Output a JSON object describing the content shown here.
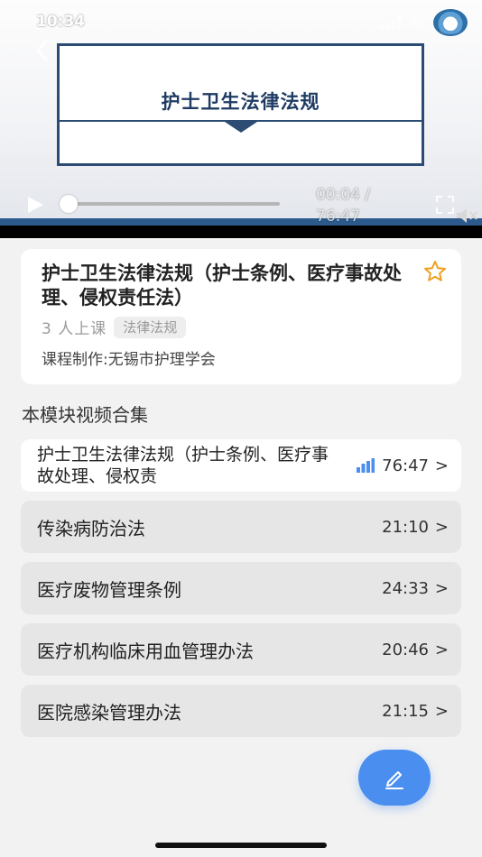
{
  "status_bar": {
    "time": "10:34"
  },
  "player": {
    "slide_title": "护士卫生法律法规",
    "current_time": "00:04 /",
    "total_time": "76:47",
    "progress": 0.0009
  },
  "course": {
    "title": "护士卫生法律法规（护士条例、医疗事故处理、侵权责任法）",
    "enroll_count": "3 人上课",
    "tag": "法律法规",
    "producer": "课程制作:无锡市护理学会"
  },
  "section": {
    "title": "本模块视频合集"
  },
  "videos": [
    {
      "title": "护士卫生法律法规（护士条例、医疗事故处理、侵权责",
      "duration": "76:47",
      "active": true
    },
    {
      "title": "传染病防治法",
      "duration": "21:10"
    },
    {
      "title": "医疗废物管理条例",
      "duration": "24:33"
    },
    {
      "title": "医疗机构临床用血管理办法",
      "duration": "20:46"
    },
    {
      "title": "医院感染管理办法",
      "duration": "21:15"
    }
  ],
  "chevron": ">",
  "colors": {
    "accent": "#4a8ef0",
    "star": "#f0a020",
    "slide_navy": "#2c4c74"
  }
}
